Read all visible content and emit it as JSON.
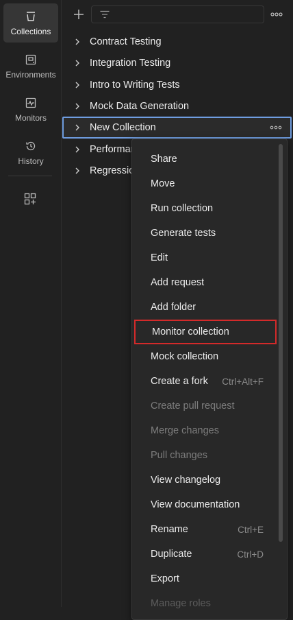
{
  "rail": {
    "items": [
      {
        "label": "Collections",
        "icon": "collections-icon",
        "active": true
      },
      {
        "label": "Environments",
        "icon": "environments-icon"
      },
      {
        "label": "Monitors",
        "icon": "monitors-icon"
      },
      {
        "label": "History",
        "icon": "history-icon"
      }
    ],
    "add_icon": "add-workspace-icon"
  },
  "toolbar": {
    "add_icon": "plus-icon",
    "filter_icon": "filter-icon",
    "more_icon": "more-horizontal-icon"
  },
  "collections": [
    {
      "label": "Contract Testing"
    },
    {
      "label": "Integration Testing"
    },
    {
      "label": "Intro to Writing Tests"
    },
    {
      "label": "Mock Data Generation"
    },
    {
      "label": "New Collection",
      "selected": true
    },
    {
      "label": "Performar"
    },
    {
      "label": "Regressio"
    }
  ],
  "context_menu": {
    "items": [
      {
        "label": "Share"
      },
      {
        "label": "Move"
      },
      {
        "label": "Run collection"
      },
      {
        "label": "Generate tests"
      },
      {
        "label": "Edit"
      },
      {
        "label": "Add request"
      },
      {
        "label": "Add folder"
      },
      {
        "label": "Monitor collection",
        "highlighted": true
      },
      {
        "label": "Mock collection"
      },
      {
        "label": "Create a fork",
        "shortcut": "Ctrl+Alt+F"
      },
      {
        "label": "Create pull request",
        "disabled": true
      },
      {
        "label": "Merge changes",
        "disabled": true
      },
      {
        "label": "Pull changes",
        "disabled": true
      },
      {
        "label": "View changelog"
      },
      {
        "label": "View documentation"
      },
      {
        "label": "Rename",
        "shortcut": "Ctrl+E"
      },
      {
        "label": "Duplicate",
        "shortcut": "Ctrl+D"
      },
      {
        "label": "Export"
      },
      {
        "label": "Manage roles",
        "partial": true
      }
    ]
  },
  "colors": {
    "background": "#212121",
    "selected_border": "#6f9de0",
    "highlight_border": "#d42a2a"
  }
}
